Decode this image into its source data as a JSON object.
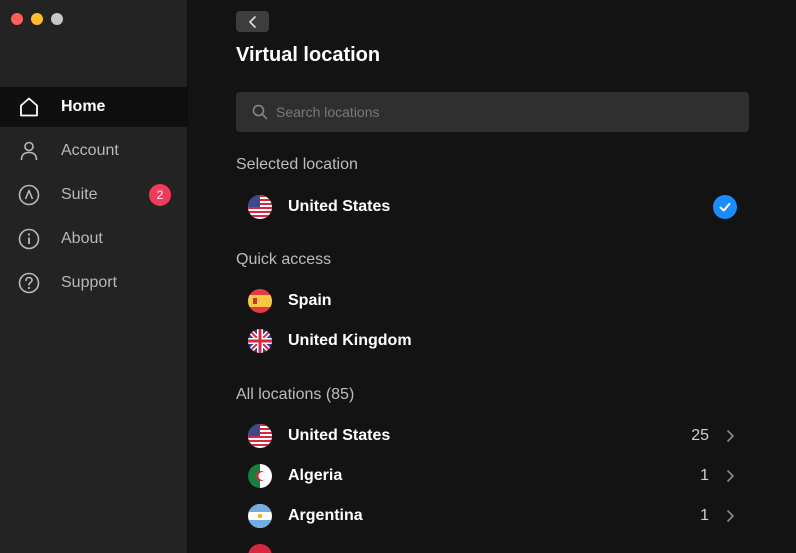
{
  "sidebar": {
    "items": [
      {
        "label": "Home",
        "icon": "home-icon",
        "active": true
      },
      {
        "label": "Account",
        "icon": "person-icon"
      },
      {
        "label": "Suite",
        "icon": "suite-icon",
        "badge": "2"
      },
      {
        "label": "About",
        "icon": "info-icon"
      },
      {
        "label": "Support",
        "icon": "question-icon"
      }
    ]
  },
  "main": {
    "title": "Virtual location",
    "search_placeholder": "Search locations",
    "selected_section": "Selected location",
    "selected": {
      "country": "United States",
      "flag": "us"
    },
    "quick_section": "Quick access",
    "quick": [
      {
        "country": "Spain",
        "flag": "es"
      },
      {
        "country": "United Kingdom",
        "flag": "gb"
      }
    ],
    "all_section": "All locations (85)",
    "all": [
      {
        "country": "United States",
        "count": "25",
        "flag": "us"
      },
      {
        "country": "Algeria",
        "count": "1",
        "flag": "dz"
      },
      {
        "country": "Argentina",
        "count": "1",
        "flag": "ar"
      }
    ]
  },
  "colors": {
    "accent": "#1a8cff",
    "badge": "#f13b5a"
  }
}
